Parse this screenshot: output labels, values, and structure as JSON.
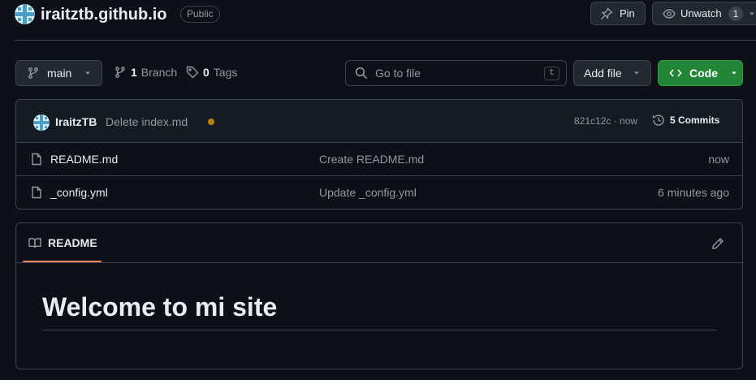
{
  "header": {
    "repo_name": "iraitztb.github.io",
    "visibility": "Public",
    "pin_label": "Pin",
    "watch_label": "Unwatch",
    "watch_count": "1"
  },
  "toolbar": {
    "branch": "main",
    "branch_count": "1",
    "branch_label": "Branch",
    "tag_count": "0",
    "tag_label": "Tags",
    "search_placeholder": "Go to file",
    "search_shortcut": "t",
    "add_file_label": "Add file",
    "code_label": "Code"
  },
  "latest_commit": {
    "author": "IraitzTB",
    "message": "Delete index.md",
    "hash_time": "821c12c · now",
    "commits_label": "5 Commits"
  },
  "files": [
    {
      "name": "README.md",
      "commit": "Create README.md",
      "date": "now"
    },
    {
      "name": "_config.yml",
      "commit": "Update _config.yml",
      "date": "6 minutes ago"
    }
  ],
  "readme": {
    "tab_label": "README",
    "heading": "Welcome to mi site"
  },
  "colors": {
    "background": "#0d1117",
    "accent_green": "#238636",
    "status_pending": "#bb8009",
    "tab_underline": "#f78166"
  },
  "icons": [
    "repo-identicon",
    "pin-icon",
    "eye-icon",
    "branch-icon",
    "tag-icon",
    "search-icon",
    "code-icon",
    "history-icon",
    "file-icon",
    "book-icon",
    "pencil-icon",
    "caret-down-icon"
  ]
}
